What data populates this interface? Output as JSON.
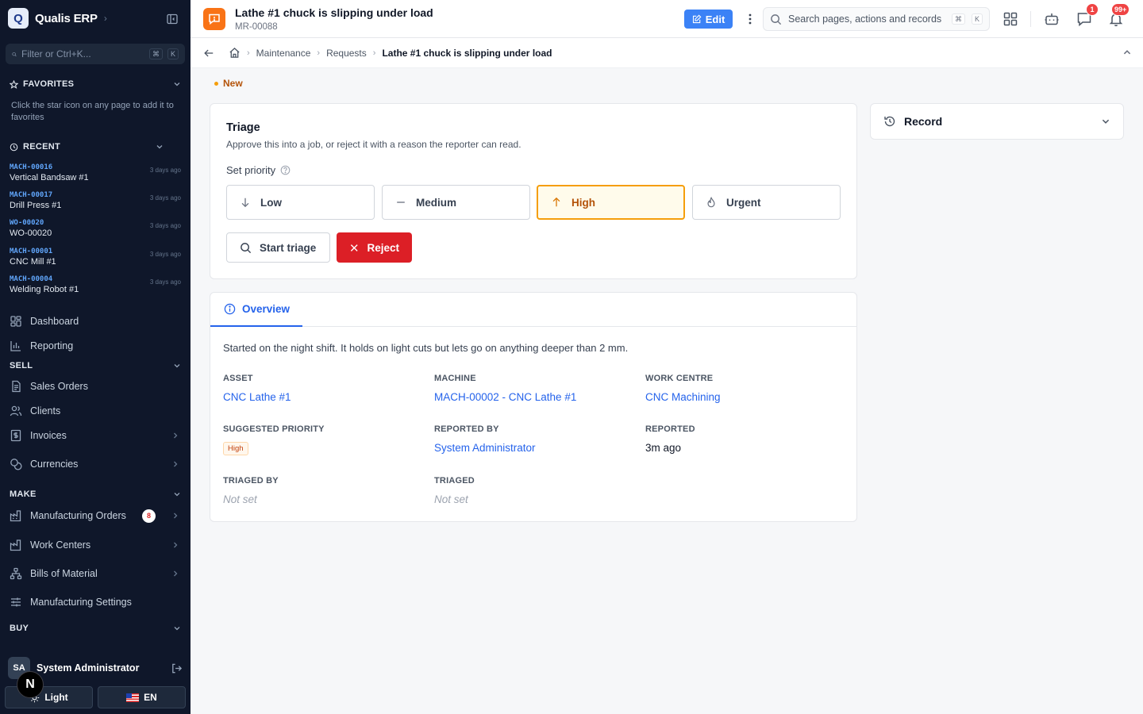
{
  "app": {
    "name": "Qualis ERP",
    "logo_letter": "Q"
  },
  "sidebar": {
    "filter_placeholder": "Filter or Ctrl+K...",
    "filter_keys": [
      "⌘",
      "K"
    ],
    "favorites": {
      "title": "FAVORITES",
      "note": "Click the star icon on any page to add it to favorites"
    },
    "recent": {
      "title": "RECENT",
      "items": [
        {
          "code": "MACH-00016",
          "name": "Vertical Bandsaw #1",
          "time": "3 days ago"
        },
        {
          "code": "MACH-00017",
          "name": "Drill Press #1",
          "time": "3 days ago"
        },
        {
          "code": "WO-00020",
          "name": "WO-00020",
          "time": "3 days ago"
        },
        {
          "code": "MACH-00001",
          "name": "CNC Mill #1",
          "time": "3 days ago"
        },
        {
          "code": "MACH-00004",
          "name": "Welding Robot #1",
          "time": "3 days ago"
        }
      ]
    },
    "nav": {
      "dashboard": "Dashboard",
      "reporting": "Reporting",
      "sell": {
        "title": "SELL",
        "sales_orders": "Sales Orders",
        "clients": "Clients",
        "invoices": "Invoices",
        "currencies": "Currencies"
      },
      "make": {
        "title": "MAKE",
        "manufacturing_orders": "Manufacturing Orders",
        "manufacturing_orders_badge": "8",
        "work_centers": "Work Centers",
        "bills_of_material": "Bills of Material",
        "manufacturing_settings": "Manufacturing Settings"
      },
      "buy": {
        "title": "BUY"
      }
    },
    "user": {
      "initials": "SA",
      "name": "System Administrator"
    },
    "theme_label": "Light",
    "lang_label": "EN"
  },
  "next_badge": "N",
  "topbar": {
    "title": "Lathe #1 chuck is slipping under load",
    "subtitle": "MR-00088",
    "edit_label": "Edit",
    "search_placeholder": "Search pages, actions and records",
    "search_keys": [
      "⌘",
      "K"
    ],
    "messages_count": "1",
    "notifications_count": "99+"
  },
  "breadcrumb": [
    "Maintenance",
    "Requests",
    "Lathe #1 chuck is slipping under load"
  ],
  "status": "New",
  "triage": {
    "title": "Triage",
    "description": "Approve this into a job, or reject it with a reason the reporter can read.",
    "priority_label": "Set priority",
    "priorities": [
      "Low",
      "Medium",
      "High",
      "Urgent"
    ],
    "selected_priority": "High",
    "start_label": "Start triage",
    "reject_label": "Reject"
  },
  "overview": {
    "tab": "Overview",
    "description": "Started on the night shift. It holds on light cuts but lets go on anything deeper than 2 mm.",
    "fields": {
      "asset": {
        "label": "ASSET",
        "value": "CNC Lathe #1"
      },
      "machine": {
        "label": "MACHINE",
        "value": "MACH-00002 - CNC Lathe #1"
      },
      "work_centre": {
        "label": "WORK CENTRE",
        "value": "CNC Machining"
      },
      "suggested_priority": {
        "label": "SUGGESTED PRIORITY",
        "value": "High"
      },
      "reported_by": {
        "label": "REPORTED BY",
        "value": "System Administrator"
      },
      "reported": {
        "label": "REPORTED",
        "value": "3m ago"
      },
      "triaged_by": {
        "label": "TRIAGED BY",
        "value": "Not set"
      },
      "triaged": {
        "label": "TRIAGED",
        "value": "Not set"
      }
    }
  },
  "record": {
    "title": "Record"
  },
  "colors": {
    "accent": "#3b82f6",
    "sidebar": "#0f172a",
    "danger": "#dc1f26",
    "warning": "#f59e0b",
    "request_icon": "#f97316"
  }
}
